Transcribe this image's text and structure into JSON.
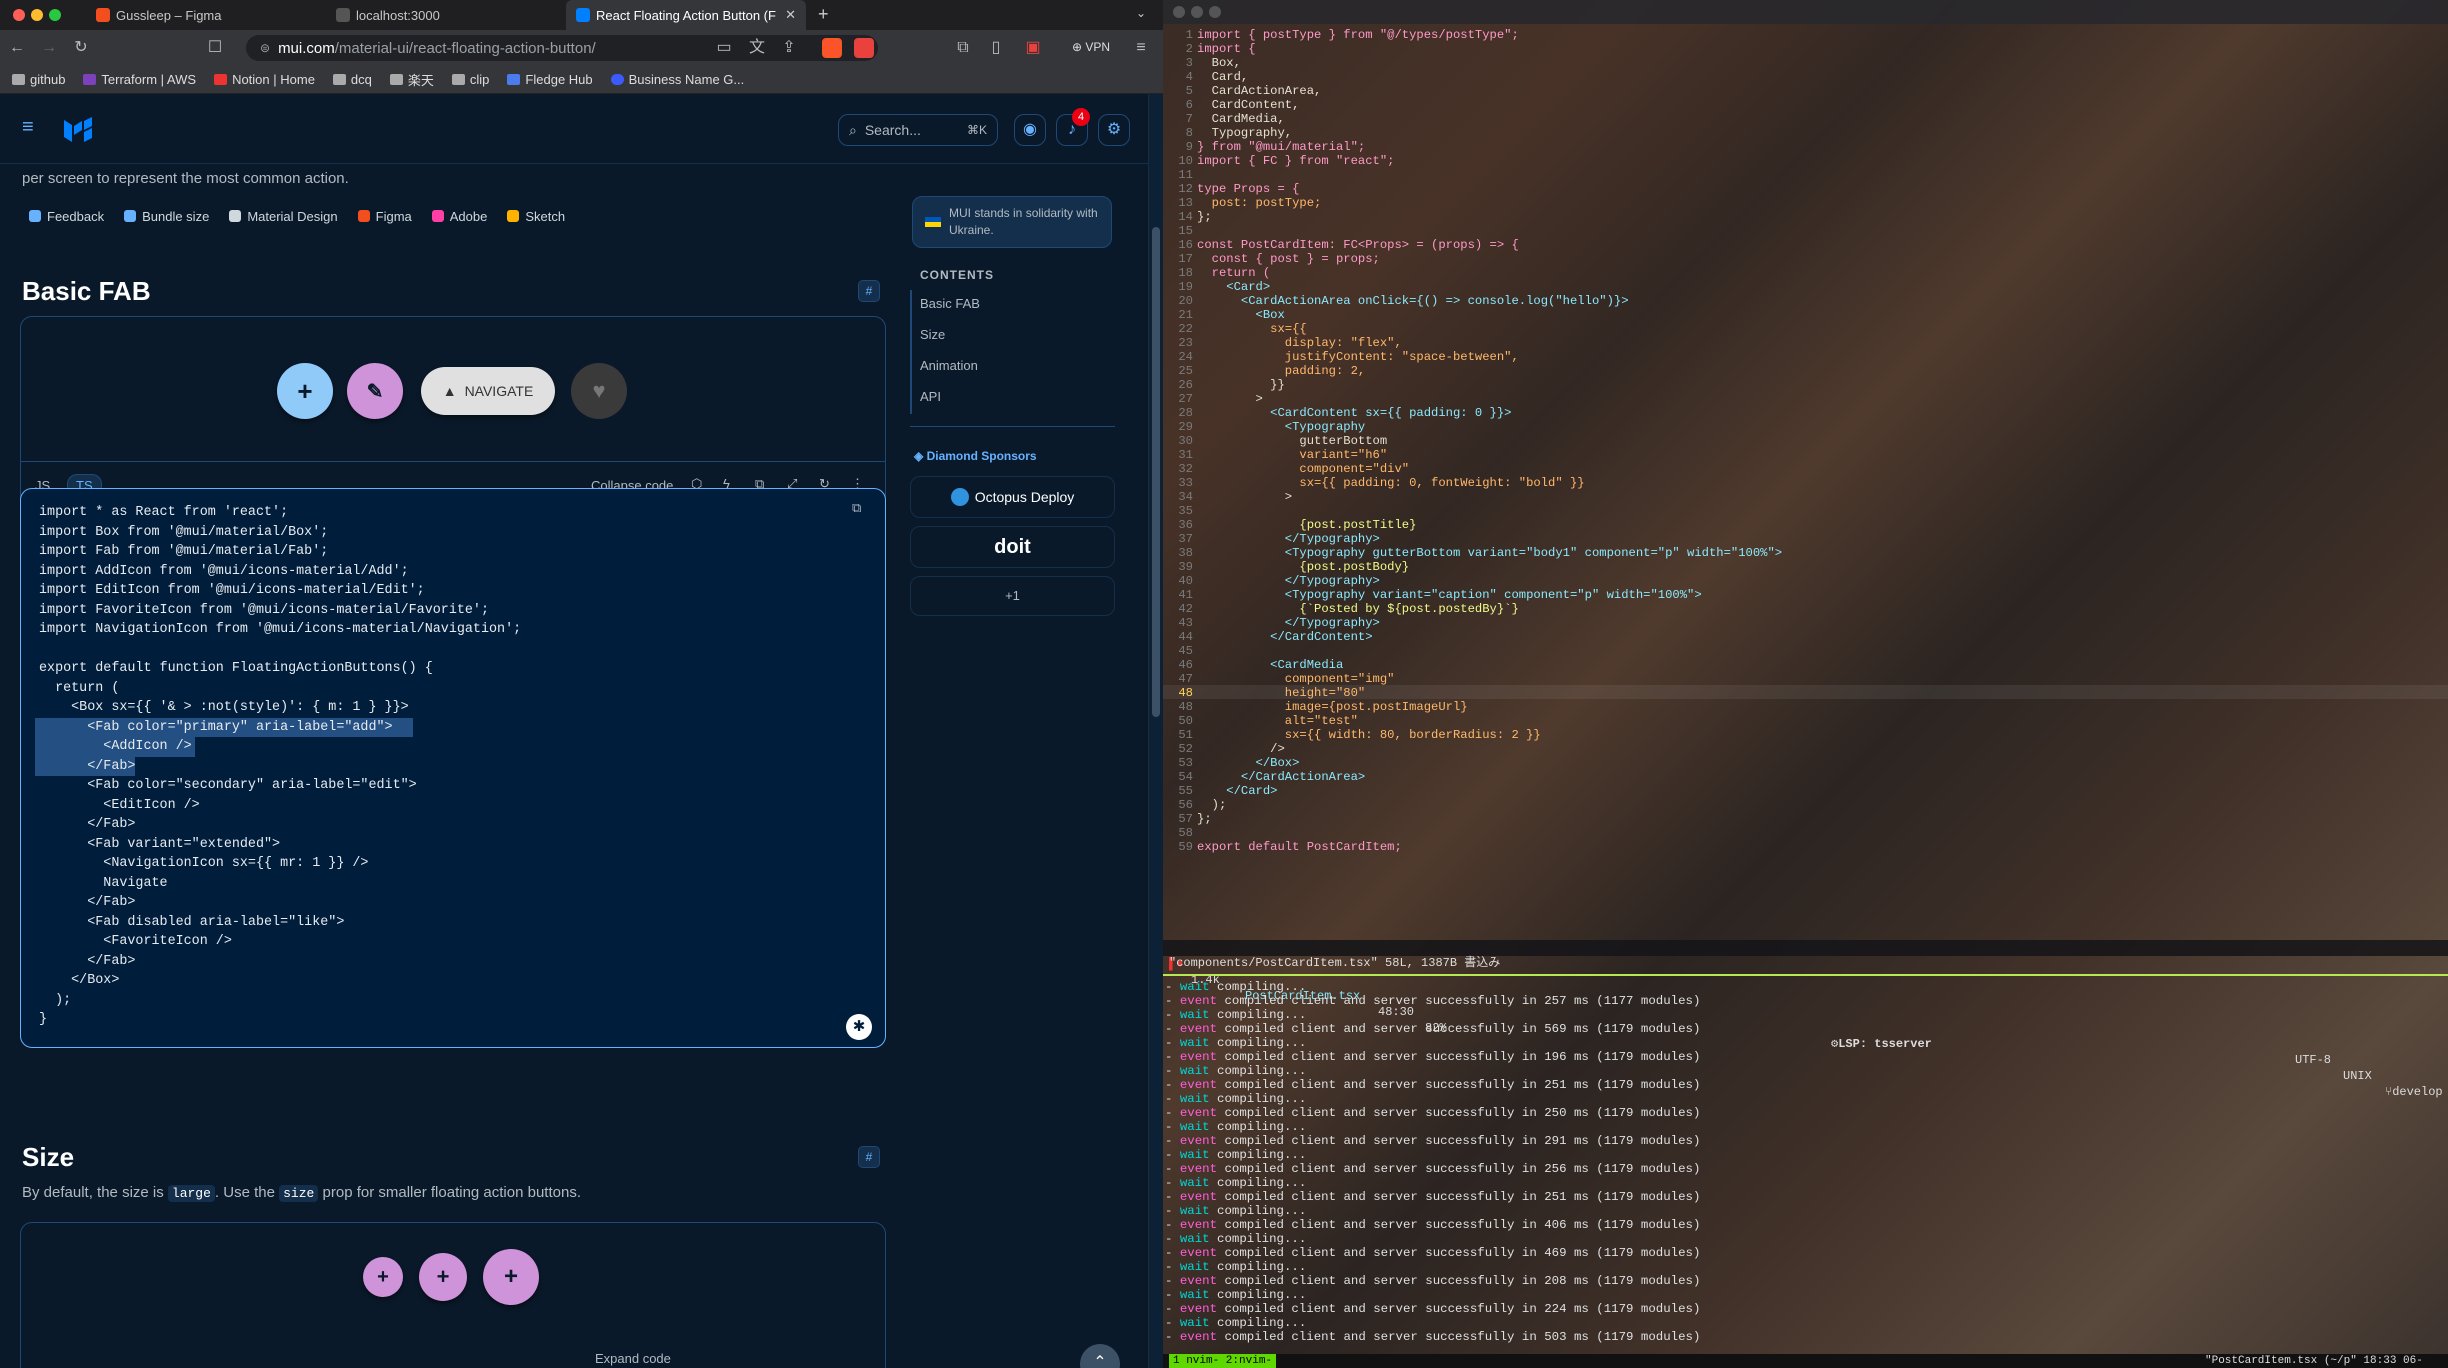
{
  "browser": {
    "tabs": [
      {
        "label": "Gussleep – Figma",
        "color": "#f24e1e"
      },
      {
        "label": "localhost:3000",
        "color": "#cccccc"
      },
      {
        "label": "React Floating Action Button (F",
        "color": "#007fff"
      }
    ],
    "new_tab": "+",
    "url_domain": "mui.com",
    "url_path": "/material-ui/react-floating-action-button/",
    "vpn": "VPN",
    "bookmarks": [
      "github",
      "Terraform | AWS",
      "Notion | Home",
      "dcq",
      "楽天",
      "clip",
      "Fledge Hub",
      "Business Name G..."
    ]
  },
  "header": {
    "search_placeholder": "Search...",
    "shortcut": "⌘K",
    "notifications": "4"
  },
  "intro": "per screen to represent the most common action.",
  "chips": [
    {
      "label": "Feedback",
      "color": "#66b2ff"
    },
    {
      "label": "Bundle size",
      "color": "#66b2ff"
    },
    {
      "label": "Material Design",
      "color": "#cfd8dc"
    },
    {
      "label": "Figma",
      "color": "#f24e1e"
    },
    {
      "label": "Adobe",
      "color": "#ff3fa4"
    },
    {
      "label": "Sketch",
      "color": "#fdb300"
    }
  ],
  "basic": {
    "title": "Basic FAB",
    "navigate": "NAVIGATE",
    "js": "JS",
    "ts": "TS",
    "collapse": "Collapse code"
  },
  "code_lines": [
    "import * as React from 'react';",
    "import Box from '@mui/material/Box';",
    "import Fab from '@mui/material/Fab';",
    "import AddIcon from '@mui/icons-material/Add';",
    "import EditIcon from '@mui/icons-material/Edit';",
    "import FavoriteIcon from '@mui/icons-material/Favorite';",
    "import NavigationIcon from '@mui/icons-material/Navigation';",
    "",
    "export default function FloatingActionButtons() {",
    "  return (",
    "    <Box sx={{ '& > :not(style)': { m: 1 } }}>",
    "      <Fab color=\"primary\" aria-label=\"add\">",
    "        <AddIcon />",
    "      </Fab>",
    "      <Fab color=\"secondary\" aria-label=\"edit\">",
    "        <EditIcon />",
    "      </Fab>",
    "      <Fab variant=\"extended\">",
    "        <NavigationIcon sx={{ mr: 1 }} />",
    "        Navigate",
    "      </Fab>",
    "      <Fab disabled aria-label=\"like\">",
    "        <FavoriteIcon />",
    "      </Fab>",
    "    </Box>",
    "  );",
    "}"
  ],
  "size": {
    "title": "Size",
    "desc_pre": "By default, the size is ",
    "code1": "large",
    "desc_mid": ". Use the ",
    "code2": "size",
    "desc_post": " prop for smaller floating action buttons.",
    "expand": "Expand code"
  },
  "sidebar": {
    "ukraine": "MUI stands in solidarity with Ukraine.",
    "contents": "CONTENTS",
    "items": [
      "Basic FAB",
      "Size",
      "Animation",
      "API"
    ],
    "sponsors": "Diamond Sponsors",
    "octopus": "Octopus Deploy",
    "doit": "doit",
    "more": "+1"
  },
  "editor": {
    "lines": [
      [
        "1",
        "import { postType } from \"@/types/postType\";"
      ],
      [
        "2",
        "import {"
      ],
      [
        "3",
        "  Box,"
      ],
      [
        "4",
        "  Card,"
      ],
      [
        "5",
        "  CardActionArea,"
      ],
      [
        "6",
        "  CardContent,"
      ],
      [
        "7",
        "  CardMedia,"
      ],
      [
        "8",
        "  Typography,"
      ],
      [
        "9",
        "} from \"@mui/material\";"
      ],
      [
        "10",
        "import { FC } from \"react\";"
      ],
      [
        "11",
        ""
      ],
      [
        "12",
        "type Props = {"
      ],
      [
        "13",
        "  post: postType;"
      ],
      [
        "14",
        "};"
      ],
      [
        "15",
        ""
      ],
      [
        "16",
        "const PostCardItem: FC<Props> = (props) => {"
      ],
      [
        "17",
        "  const { post } = props;"
      ],
      [
        "18",
        "  return ("
      ],
      [
        "19",
        "    <Card>"
      ],
      [
        "20",
        "      <CardActionArea onClick={() => console.log(\"hello\")}>"
      ],
      [
        "21",
        "        <Box"
      ],
      [
        "22",
        "          sx={{"
      ],
      [
        "23",
        "            display: \"flex\","
      ],
      [
        "24",
        "            justifyContent: \"space-between\","
      ],
      [
        "25",
        "            padding: 2,"
      ],
      [
        "26",
        "          }}"
      ],
      [
        "27",
        "        >"
      ],
      [
        "28",
        "          <CardContent sx={{ padding: 0 }}>"
      ],
      [
        "29",
        "            <Typography"
      ],
      [
        "30",
        "              gutterBottom"
      ],
      [
        "31",
        "              variant=\"h6\""
      ],
      [
        "32",
        "              component=\"div\""
      ],
      [
        "33",
        "              sx={{ padding: 0, fontWeight: \"bold\" }}"
      ],
      [
        "34",
        "            >"
      ],
      [
        "35",
        ""
      ],
      [
        "36",
        "              {post.postTitle}"
      ],
      [
        "37",
        "            </Typography>"
      ],
      [
        "38",
        "            <Typography gutterBottom variant=\"body1\" component=\"p\" width=\"100%\">"
      ],
      [
        "39",
        "              {post.postBody}"
      ],
      [
        "40",
        "            </Typography>"
      ],
      [
        "41",
        "            <Typography variant=\"caption\" component=\"p\" width=\"100%\">"
      ],
      [
        "42",
        "              {`Posted by ${post.postedBy}`}"
      ],
      [
        "43",
        "            </Typography>"
      ],
      [
        "44",
        "          </CardContent>"
      ],
      [
        "45",
        ""
      ],
      [
        "46",
        "          <CardMedia"
      ],
      [
        "47",
        "            component=\"img\""
      ],
      [
        "48",
        "            height=\"80\""
      ],
      [
        "48",
        "            image={post.postImageUrl}"
      ],
      [
        "50",
        "            alt=\"test\""
      ],
      [
        "51",
        "            sx={{ width: 80, borderRadius: 2 }}"
      ],
      [
        "52",
        "          />"
      ],
      [
        "53",
        "        </Box>"
      ],
      [
        "54",
        "      </CardActionArea>"
      ],
      [
        "55",
        "    </Card>"
      ],
      [
        "56",
        "  );"
      ],
      [
        "57",
        "};"
      ],
      [
        "58",
        ""
      ],
      [
        "59",
        "export default PostCardItem;"
      ]
    ],
    "status": {
      "size": "1.4k",
      "file": "PostCardItem.tsx",
      "pos": "48:30",
      "pct": "82%",
      "lsp": "LSP: tsserver",
      "enc": "UTF-8",
      "ff": "UNIX",
      "branch": "develop"
    },
    "msg": "\"components/PostCardItem.tsx\" 58L, 1387B 書込み",
    "terminal": [
      [
        "wait",
        "compiling..."
      ],
      [
        "event",
        "compiled client and server successfully in 257 ms (1177 modules)"
      ],
      [
        "wait",
        "compiling..."
      ],
      [
        "event",
        "compiled client and server successfully in 569 ms (1179 modules)"
      ],
      [
        "wait",
        "compiling..."
      ],
      [
        "event",
        "compiled client and server successfully in 196 ms (1179 modules)"
      ],
      [
        "wait",
        "compiling..."
      ],
      [
        "event",
        "compiled client and server successfully in 251 ms (1179 modules)"
      ],
      [
        "wait",
        "compiling..."
      ],
      [
        "event",
        "compiled client and server successfully in 250 ms (1179 modules)"
      ],
      [
        "wait",
        "compiling..."
      ],
      [
        "event",
        "compiled client and server successfully in 291 ms (1179 modules)"
      ],
      [
        "wait",
        "compiling..."
      ],
      [
        "event",
        "compiled client and server successfully in 256 ms (1179 modules)"
      ],
      [
        "wait",
        "compiling..."
      ],
      [
        "event",
        "compiled client and server successfully in 251 ms (1179 modules)"
      ],
      [
        "wait",
        "compiling..."
      ],
      [
        "event",
        "compiled client and server successfully in 406 ms (1179 modules)"
      ],
      [
        "wait",
        "compiling..."
      ],
      [
        "event",
        "compiled client and server successfully in 469 ms (1179 modules)"
      ],
      [
        "wait",
        "compiling..."
      ],
      [
        "event",
        "compiled client and server successfully in 208 ms (1179 modules)"
      ],
      [
        "wait",
        "compiling..."
      ],
      [
        "event",
        "compiled client and server successfully in 224 ms (1179 modules)"
      ],
      [
        "wait",
        "compiling..."
      ],
      [
        "event",
        "compiled client and server successfully in 503 ms (1179 modules)"
      ]
    ],
    "tmux_left": "1 nvim- 2:nvim-",
    "tmux_right": "\"PostCardItem.tsx (~/p\" 18:33 06-"
  }
}
